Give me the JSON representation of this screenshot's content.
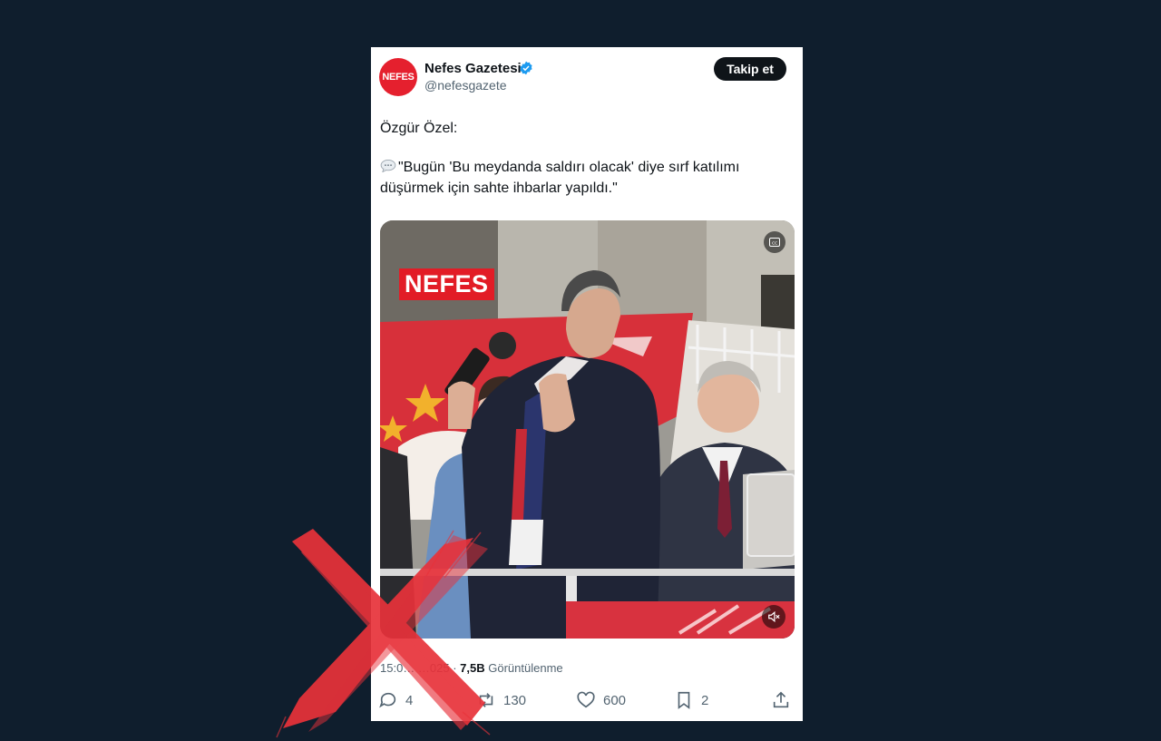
{
  "tweet": {
    "author_name": "Nefes Gazetesi",
    "author_handle": "@nefesgazete",
    "avatar_text": "NEFES",
    "verified": true,
    "follow_label": "Takip et",
    "text_line1": "Özgür Özel:",
    "text_quote": "\"Bugün 'Bu meydanda saldırı olacak' diye sırf katılımı düşürmek için sahte ihbarlar yapıldı.\"",
    "media": {
      "overlay_logo": "NEFES",
      "cc_icon": "closed-captions-icon",
      "mute_icon": "speaker-muted-icon"
    },
    "meta": {
      "time_date": "15:0… …025 ·",
      "views_count": "7,5B",
      "views_label": "Görüntülenme"
    },
    "actions": {
      "replies": "4",
      "retweets": "130",
      "likes": "600",
      "bookmarks": "2"
    }
  },
  "overlay": {
    "marker": "red-x-mark",
    "color": "#e8323a"
  },
  "colors": {
    "background": "#0f1e2d",
    "brand_red": "#e5202e",
    "verified_blue": "#1d9bf0",
    "text_primary": "#0f1419",
    "text_secondary": "#536471"
  }
}
